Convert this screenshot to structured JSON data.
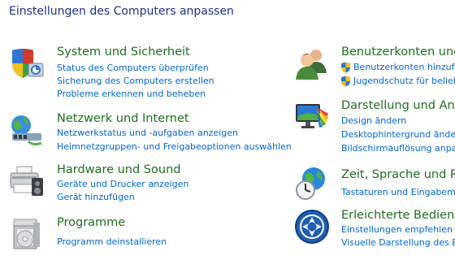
{
  "header": {
    "title": "Einstellungen des Computers anpassen"
  },
  "left_categories": [
    {
      "icon": "system-security-shield-icon",
      "title": "System und Sicherheit",
      "links": [
        "Status des Computers überprüfen",
        "Sicherung des Computers erstellen",
        "Probleme erkennen und beheben"
      ]
    },
    {
      "icon": "network-globe-icon",
      "title": "Netzwerk und Internet",
      "links": [
        "Netzwerkstatus und -aufgaben anzeigen",
        "Heimnetzgruppen- und Freigabeoptionen auswählen"
      ]
    },
    {
      "icon": "printer-hardware-icon",
      "title": "Hardware und Sound",
      "links": [
        "Geräte und Drucker anzeigen",
        "Gerät hinzufügen"
      ]
    },
    {
      "icon": "programs-box-icon",
      "title": "Programme",
      "links": [
        "Programm deinstallieren"
      ]
    }
  ],
  "right_categories": [
    {
      "icon": "user-accounts-icon",
      "title": "Benutzerkonten und",
      "links": [
        "Benutzerkonten hinzufü",
        "Jugendschutz für belieb"
      ]
    },
    {
      "icon": "appearance-monitor-icon",
      "title": "Darstellung und Anp",
      "links": [
        "Design ändern",
        "Desktophintergrund ände",
        "Bildschirmauflösung anpas"
      ]
    },
    {
      "icon": "clock-globe-icon",
      "title": "Zeit, Sprache und Re",
      "links": [
        "Tastaturen und Eingabem"
      ]
    },
    {
      "icon": "ease-of-access-icon",
      "title": "Erleichterte Bedienun",
      "links": [
        "Einstellungen empfehlen la",
        "Visuelle Darstellung des Bil"
      ]
    }
  ]
}
